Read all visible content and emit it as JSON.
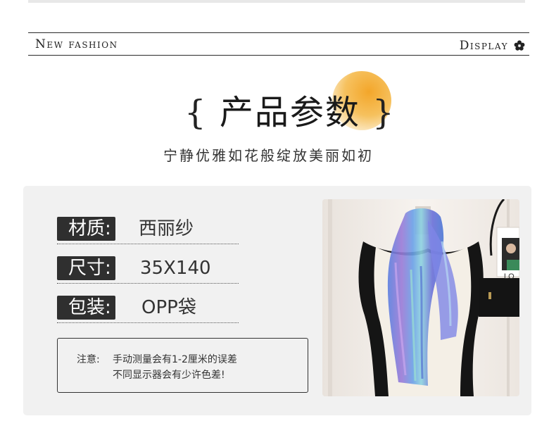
{
  "header": {
    "left_label": "New fashion",
    "right_label": "Display",
    "icon": "flower-icon"
  },
  "title": {
    "open_brace": "{",
    "text": "产品参数",
    "close_brace": "}"
  },
  "subtitle": "宁静优雅如花般绽放美丽如初",
  "specs": [
    {
      "label": "材质:",
      "value": "西丽纱"
    },
    {
      "label": "尺寸:",
      "value": "35X140"
    },
    {
      "label": "包装:",
      "value": "OPP袋"
    }
  ],
  "note": {
    "label": "注意:",
    "line1": "手动测量会有1-2厘米的误差",
    "line2": "不同显示器会有少许色差!"
  },
  "photo": {
    "poster_text": "LO",
    "colors": {
      "scarf_blue": "#4b78d6",
      "scarf_purple": "#8b6fd0",
      "vest": "#1a1a1a",
      "bag": "#141414"
    }
  },
  "colors": {
    "accent_orange": "#f3a62a",
    "label_bg": "#2f2f2f",
    "panel_bg": "#f1f1f1"
  }
}
